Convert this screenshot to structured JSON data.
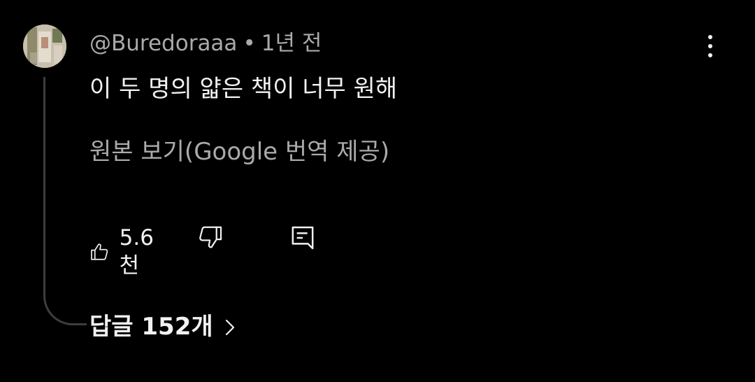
{
  "comment": {
    "author": "@Buredoraaa",
    "separator": "•",
    "timestamp": "1년 전",
    "text": "이 두 명의 얇은 책이 너무 원해",
    "translation_link": "원본 보기(Google 번역 제공)",
    "like_count": "5.6천",
    "replies_label": "답글 152개"
  },
  "icons": {
    "avatar": "avatar-image",
    "more": "more-vertical-icon",
    "like": "thumbs-up-icon",
    "dislike": "thumbs-down-icon",
    "reply": "reply-comment-icon",
    "chevron": "chevron-right-icon"
  },
  "colors": {
    "background": "#000000",
    "primary_text": "#f1f1f1",
    "secondary_text": "#aaaaaa",
    "thread_line": "#3d3d3d"
  }
}
